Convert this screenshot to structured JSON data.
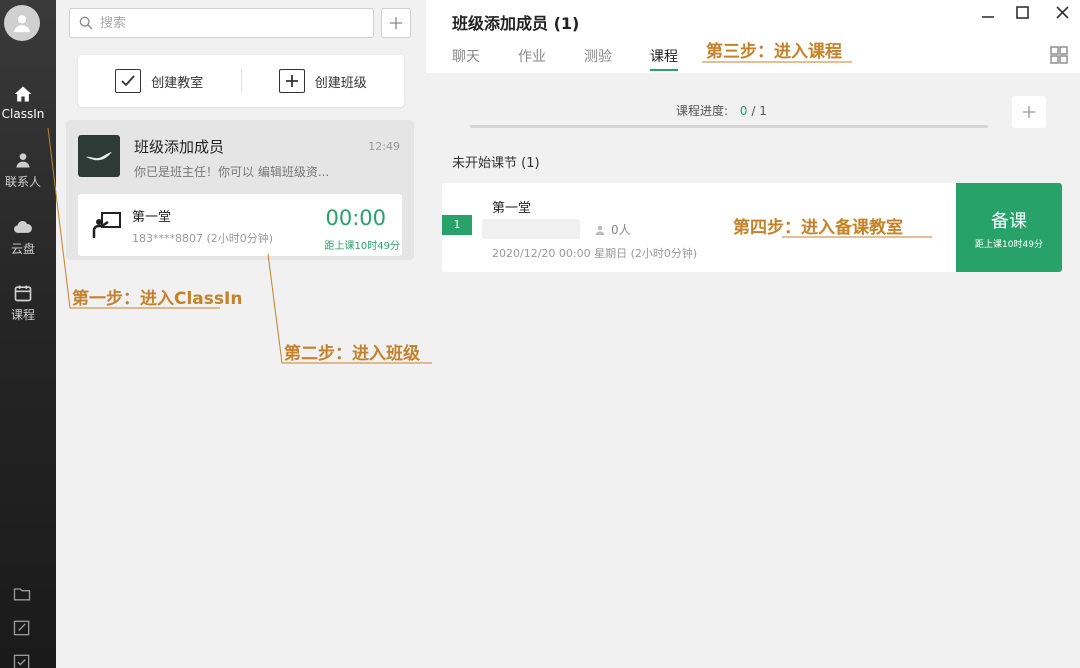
{
  "rail": {
    "items": [
      {
        "label": "ClassIn",
        "icon": "home-icon"
      },
      {
        "label": "联系人",
        "icon": "contacts-icon"
      },
      {
        "label": "云盘",
        "icon": "cloud-icon"
      },
      {
        "label": "课程",
        "icon": "calendar-icon"
      }
    ]
  },
  "mid": {
    "search_placeholder": "搜索",
    "create_classroom": "创建教室",
    "create_class": "创建班级",
    "class_card": {
      "name": "班级添加成员",
      "time": "12:49",
      "message": "你已是班主任！你可以 编辑班级资..."
    },
    "lesson": {
      "name": "第一堂",
      "meta": "183****8807 (2小时0分钟)",
      "clock": "00:00",
      "countdown": "距上课10时49分"
    }
  },
  "right": {
    "title": "班级添加成员 (1)",
    "tabs": [
      "聊天",
      "作业",
      "测验",
      "课程"
    ],
    "active_tab": "课程",
    "progress_label": "课程进度:",
    "progress_done": "0",
    "progress_total": "/ 1",
    "progress_fraction": 0,
    "section_title": "未开始课节 (1)",
    "course": {
      "index": "1",
      "name": "第一堂",
      "people": "0人",
      "date": "2020/12/20 00:00 星期日 (2小时0分钟)",
      "prep_label": "备课",
      "prep_countdown": "距上课10时49分"
    }
  },
  "annotations": {
    "step1": "第一步：进入ClassIn",
    "step2": "第二步：进入班级",
    "step3": "第三步：进入课程",
    "step4": "第四步：进入备课教室"
  },
  "colors": {
    "accent": "#27a36a",
    "annotation": "#c4822a",
    "rail": "#262626"
  }
}
